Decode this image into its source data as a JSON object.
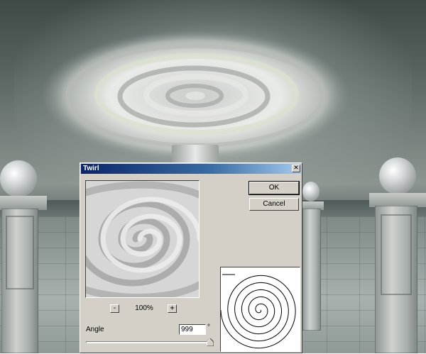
{
  "dialog": {
    "title": "Twirl",
    "close_glyph": "✕",
    "ok_label": "OK",
    "cancel_label": "Cancel",
    "zoom": {
      "minus_label": "-",
      "level": "100%",
      "plus_label": "+"
    },
    "angle": {
      "label": "Angle",
      "value": "999",
      "unit": "°",
      "slider_position": 1.0
    }
  },
  "icons": {
    "close": "close-icon",
    "zoom_out": "minus-icon",
    "zoom_in": "plus-icon",
    "slider": "slider-thumb-icon",
    "spiral": "spiral-icon"
  },
  "colors": {
    "dialog_face": "#d4d0c8",
    "titlebar_start": "#0a246a",
    "titlebar_end": "#a6caf0"
  }
}
